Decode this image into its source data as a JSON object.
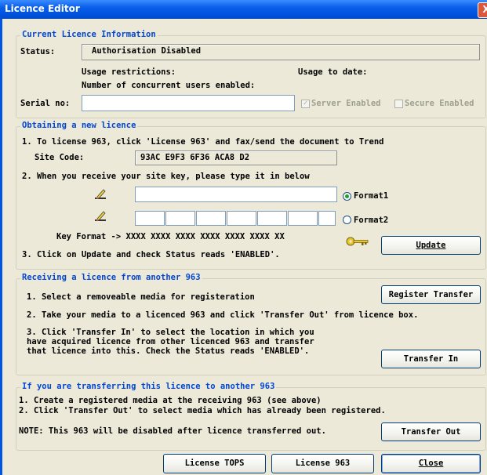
{
  "window": {
    "title": "Licence Editor",
    "close_glyph": "X"
  },
  "current": {
    "legend": "Current Licence Information",
    "status_label": "Status:",
    "status_value": "Authorisation Disabled",
    "usage_restrictions": "Usage restrictions:",
    "usage_to_date": "Usage to date:",
    "concurrent_users": "Number of concurrent users enabled:",
    "serial_label": "Serial no:",
    "serial_value": "",
    "server_enabled": {
      "label": "Server Enabled",
      "checked": true,
      "enabled": false
    },
    "secure_enabled": {
      "label": "Secure Enabled",
      "checked": false,
      "enabled": false
    }
  },
  "obtain": {
    "legend": "Obtaining a new licence",
    "step1": "1. To license 963, click 'License 963' and fax/send the document to Trend",
    "site_code_label": "Site Code:",
    "site_code_value": "93AC E9F3 6F36 ACA8 D2",
    "step2": "2. When you receive your site key, please type it in below",
    "format1": "Format1",
    "format2": "Format2",
    "selected_format": "Format1",
    "key_format": "Key Format -> XXXX XXXX XXXX XXXX XXXX XXXX XX",
    "step3": "3. Click on Update and check Status reads 'ENABLED'.",
    "update_button": "Update"
  },
  "receive": {
    "legend": "Receiving a licence from another 963",
    "step1": "1. Select a removeable media for registeration",
    "register_button": "Register Transfer",
    "step2": "2. Take your media to a licenced 963 and click 'Transfer Out' from licence box.",
    "step3_line1": "3. Click 'Transfer In' to select the location in which you",
    "step3_line2": "have acquired licence from other licenced 963 and transfer",
    "step3_line3": "that licence into this. Check the Status reads 'ENABLED'.",
    "transfer_in_button": "Transfer In"
  },
  "transfer": {
    "legend": "If you are transferring this licence to another 963",
    "line1": "1. Create a registered media at the receiving 963 (see above)",
    "line2": "2. Click 'Transfer Out' to select media which has already been registered.",
    "note": "NOTE: This 963 will be disabled after licence transferred out.",
    "transfer_out_button": "Transfer Out"
  },
  "footer": {
    "license_tops": "License TOPS",
    "license_963": "License 963",
    "close": "Close"
  },
  "icons": [
    "pencil-icon",
    "pencil-icon",
    "key-icon"
  ],
  "colors": {
    "title_bar": "#0054E3",
    "legend_text": "#0046D5",
    "dialog_bg": "#ECE9D8"
  }
}
